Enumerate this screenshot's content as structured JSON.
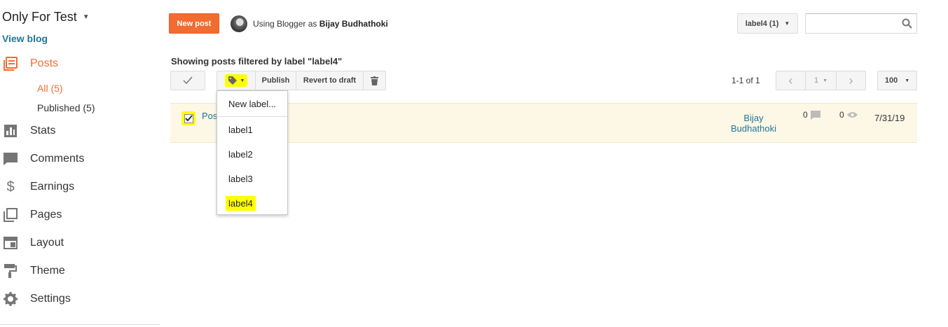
{
  "sidebar": {
    "blog_title": "Only For Test",
    "view_blog": "View blog",
    "nav": {
      "posts": "Posts",
      "stats": "Stats",
      "comments": "Comments",
      "earnings": "Earnings",
      "pages": "Pages",
      "layout": "Layout",
      "theme": "Theme",
      "settings": "Settings"
    },
    "posts_sub": {
      "all": "All (5)",
      "published": "Published (5)"
    },
    "active_color": "#f26c31"
  },
  "header": {
    "new_post": "New post",
    "using_prefix": "Using Blogger as",
    "user_name": "Bijay Budhathoki",
    "label_filter": "label4 (1)",
    "search_placeholder": ""
  },
  "main": {
    "filter_heading": "Showing posts filtered by label \"label4\"",
    "toolbar": {
      "publish": "Publish",
      "revert": "Revert to draft"
    },
    "pager": {
      "count": "1-1 of 1",
      "page": "1",
      "per_page": "100"
    },
    "posts": [
      {
        "title": "Pos",
        "author": "Bijay Budhathoki",
        "comments": "0",
        "views": "0",
        "date": "7/31/19",
        "checked": true
      }
    ]
  },
  "label_menu": {
    "new_label": "New label...",
    "labels": [
      "label1",
      "label2",
      "label3",
      "label4"
    ],
    "highlighted": "label4"
  },
  "colors": {
    "accent": "#f26c31",
    "link": "#21759b",
    "highlight": "#ffff00",
    "row_bg": "#fdf8e6"
  }
}
